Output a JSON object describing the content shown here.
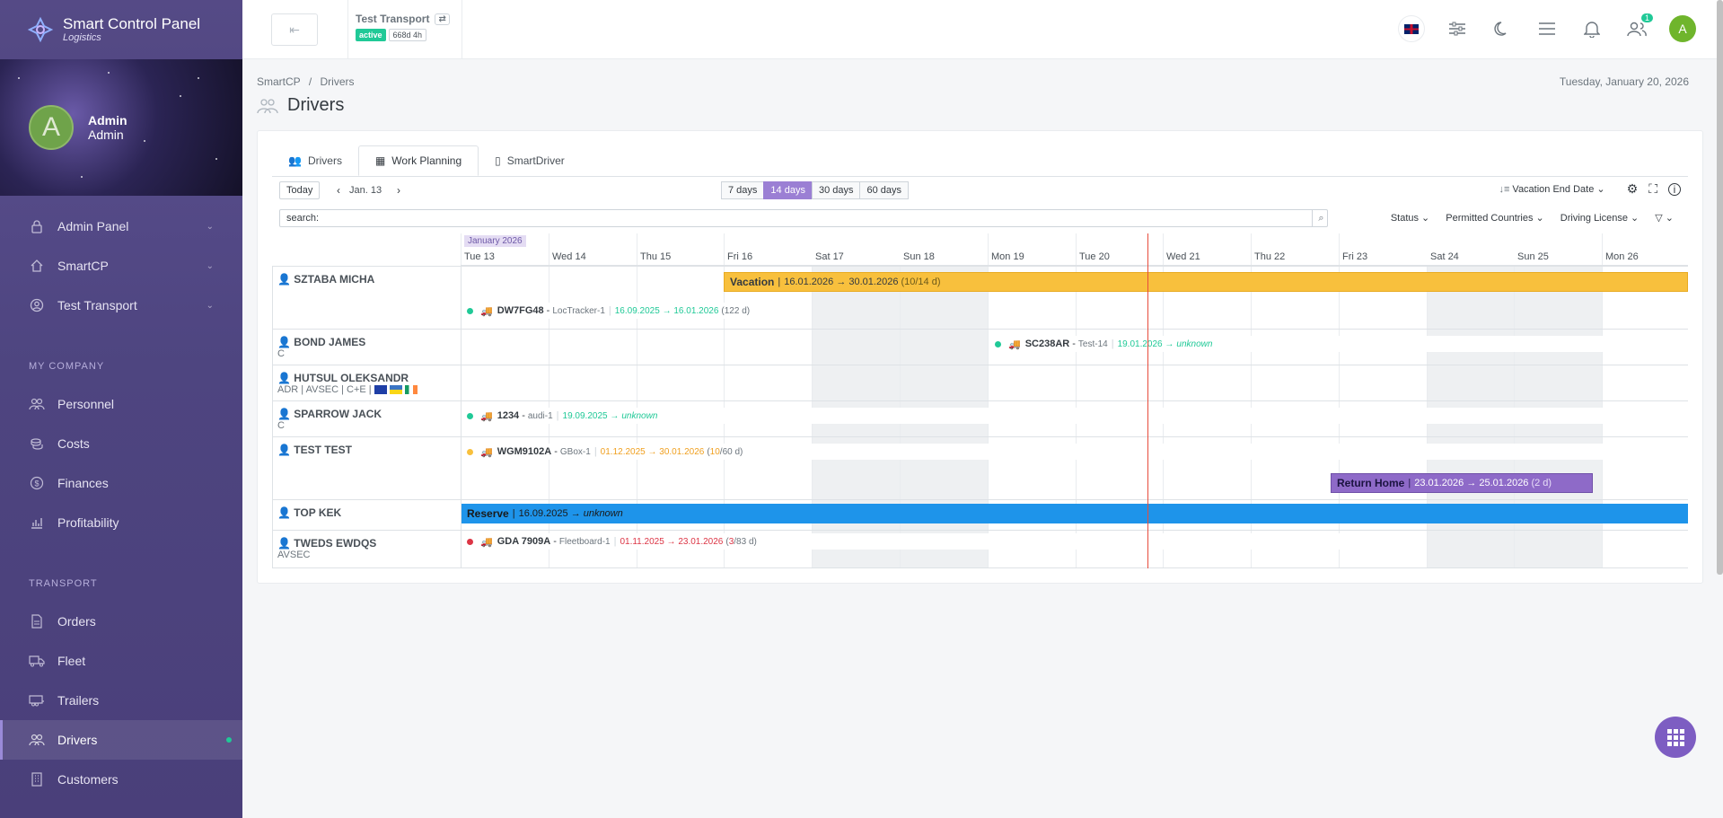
{
  "brand": {
    "title": "Smart Control Panel",
    "subtitle": "Logistics"
  },
  "profile": {
    "initial": "A",
    "name": "Admin",
    "role": "Admin"
  },
  "sidebar": {
    "items_top": [
      {
        "label": "Admin Panel",
        "icon": "lock-icon"
      },
      {
        "label": "SmartCP",
        "icon": "home-icon"
      },
      {
        "label": "Test Transport",
        "icon": "user-circle-icon"
      }
    ],
    "section_company": "MY COMPANY",
    "items_company": [
      {
        "label": "Personnel",
        "icon": "users-icon"
      },
      {
        "label": "Costs",
        "icon": "coins-icon"
      },
      {
        "label": "Finances",
        "icon": "dollar-icon"
      },
      {
        "label": "Profitability",
        "icon": "chart-icon"
      }
    ],
    "section_transport": "TRANSPORT",
    "items_transport": [
      {
        "label": "Orders",
        "icon": "document-icon"
      },
      {
        "label": "Fleet",
        "icon": "truck-icon"
      },
      {
        "label": "Trailers",
        "icon": "trailer-icon"
      },
      {
        "label": "Drivers",
        "icon": "drivers-icon"
      },
      {
        "label": "Customers",
        "icon": "building-icon"
      }
    ]
  },
  "topbar": {
    "company": "Test Transport",
    "status": "active",
    "uptime": "668d 4h",
    "notif_count": "1",
    "user_initial": "A"
  },
  "breadcrumb": {
    "root": "SmartCP",
    "sep": "/",
    "current": "Drivers"
  },
  "date": "Tuesday, January 20, 2026",
  "page_title": "Drivers",
  "tabs": [
    "Drivers",
    "Work Planning",
    "SmartDriver"
  ],
  "toolbar": {
    "today": "Today",
    "start_date": "Jan. 13",
    "ranges": [
      "7 days",
      "14 days",
      "30 days",
      "60 days"
    ],
    "sort_label": "Vacation End Date"
  },
  "search": {
    "value": "search:"
  },
  "filters": [
    "Status",
    "Permitted Countries",
    "Driving License"
  ],
  "calendar": {
    "month": "January 2026",
    "days": [
      "Tue 13",
      "Wed 14",
      "Thu 15",
      "Fri 16",
      "Sat 17",
      "Sun 18",
      "Mon 19",
      "Tue 20",
      "Wed 21",
      "Thu 22",
      "Fri 23",
      "Sat 24",
      "Sun 25",
      "Mon 26"
    ]
  },
  "drivers": [
    {
      "name": "SZTABA MICHA",
      "sub": ""
    },
    {
      "name": "BOND JAMES",
      "sub": "C"
    },
    {
      "name": "HUTSUL OLEKSANDR",
      "sub": "ADR | AVSEC | C+E |"
    },
    {
      "name": "SPARROW JACK",
      "sub": "C"
    },
    {
      "name": "TEST TEST",
      "sub": ""
    },
    {
      "name": "TOP KEK",
      "sub": ""
    },
    {
      "name": "TWEDS EWDQS",
      "sub": "AVSEC"
    }
  ],
  "events": {
    "vacation": {
      "label": "Vacation",
      "range": "16.01.2026 → 30.01.2026",
      "count": "(10/14 d)"
    },
    "return_home": {
      "label": "Return Home",
      "range": "23.01.2026 → 25.01.2026",
      "count": "(2 d)"
    },
    "reserve": {
      "label": "Reserve",
      "start": "16.09.2025 →",
      "end": "unknown"
    }
  },
  "vehicles": [
    {
      "plate": "DW7FG48",
      "tracker": "LocTracker-1",
      "range": "16.09.2025 → 16.01.2026",
      "extra": "(122 d)"
    },
    {
      "plate": "SC238AR",
      "tracker": "Test-14",
      "range": "19.01.2026 →",
      "extra": "unknown"
    },
    {
      "plate": "1234",
      "tracker": "audi-1",
      "range": "19.09.2025 →",
      "extra": "unknown"
    },
    {
      "plate": "WGM9102A",
      "tracker": "GBox-1",
      "range": "01.12.2025 → 30.01.2026",
      "extra_a": "(",
      "extra_b": "10",
      "extra_c": "/60 d)"
    },
    {
      "plate": "GDA 7909A",
      "tracker": "Fleetboard-1",
      "range": "01.11.2025 → 23.01.2026",
      "extra_a": "(",
      "extra_b": "3",
      "extra_c": "/83 d)"
    }
  ],
  "colors": {
    "accent": "#9b7fd4",
    "vacation": "#f8c03d",
    "return_home": "#8e6ac8",
    "reserve": "#1e94ea",
    "today_line": "#e74c3c"
  }
}
